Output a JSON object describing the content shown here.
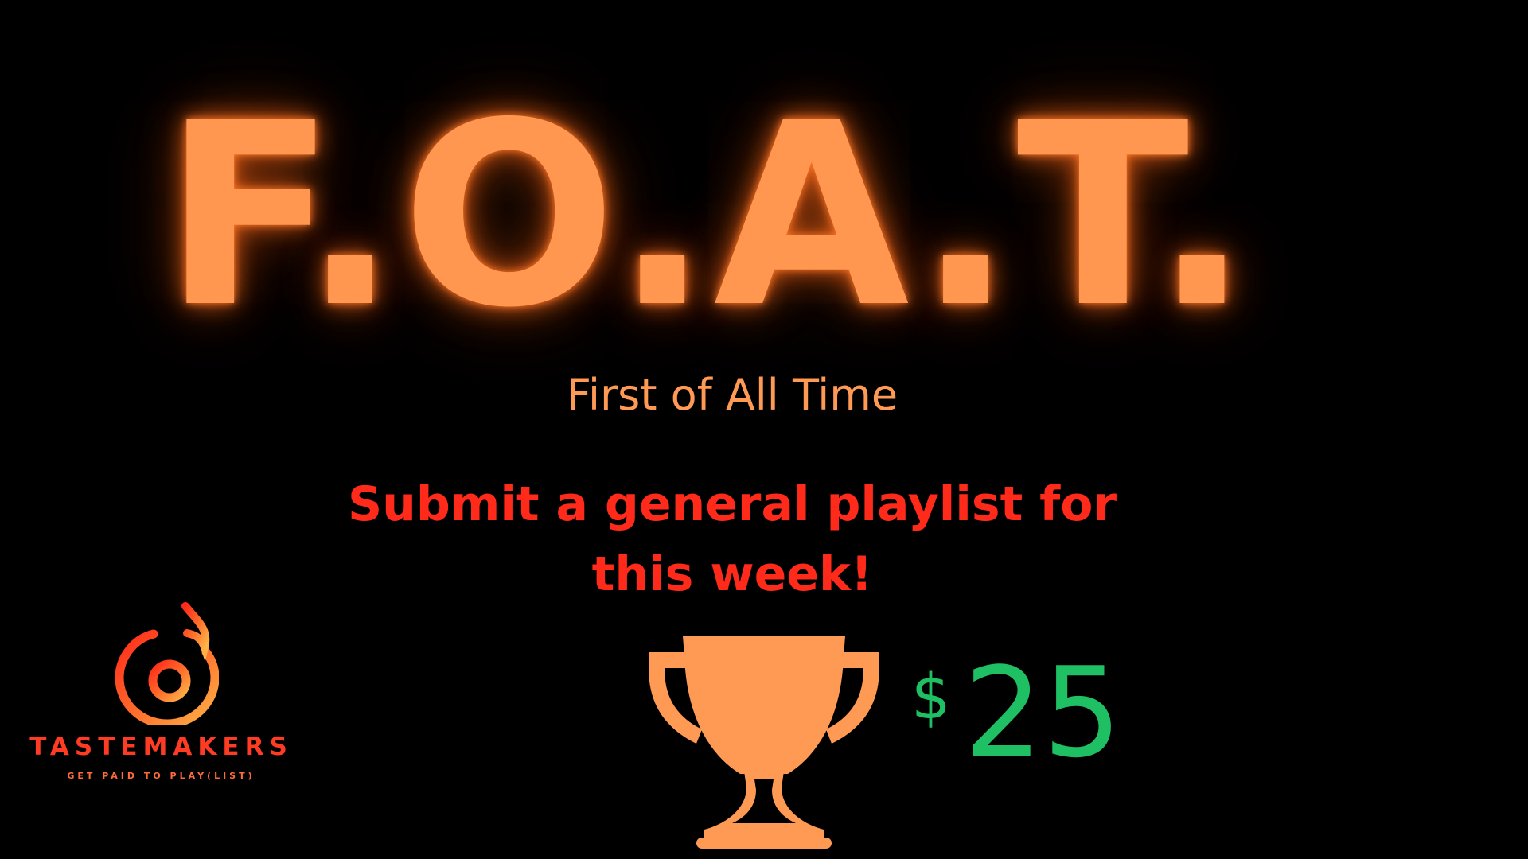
{
  "title": "F.O.A.T.",
  "subtitle": "First of All Time",
  "cta": "Submit a general playlist for this week!",
  "prize": {
    "currency": "$",
    "amount": "25",
    "icon": "trophy-icon"
  },
  "brand": {
    "name": "TASTEMAKERS",
    "tagline": "GET PAID TO PLAY(LIST)",
    "icon": "music-note-flame-icon"
  },
  "colors": {
    "background": "#000000",
    "title": "#ff9750",
    "subtitle": "#ff9a55",
    "cta": "#ff2a1a",
    "trophy": "#ff9a55",
    "prize": "#1fbf63",
    "brand": "#ff3b24"
  }
}
